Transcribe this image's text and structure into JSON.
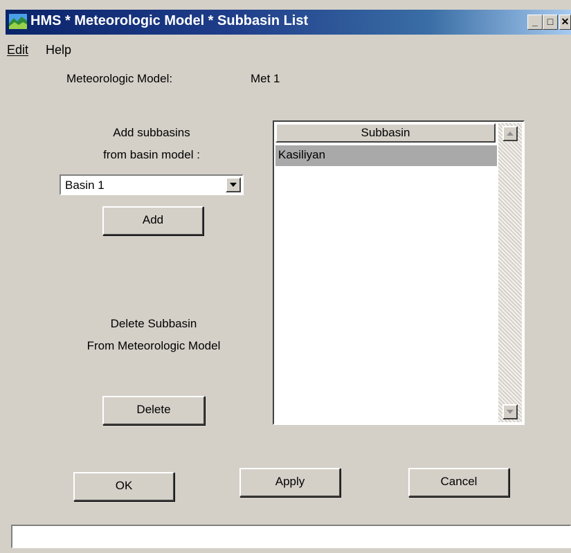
{
  "window": {
    "title": "HMS * Meteorologic Model * Subbasin List",
    "title_bar_color": "#0a246a",
    "face_color": "#d4d0c8",
    "caption_buttons": [
      "minimize",
      "maximize",
      "close"
    ]
  },
  "menu": {
    "items": [
      {
        "label": "Edit",
        "mnemonic": "E"
      },
      {
        "label": "Help"
      }
    ]
  },
  "met_model": {
    "label": "Meteorologic Model:",
    "value": "Met 1"
  },
  "add_section": {
    "label_line1": "Add subbasins",
    "label_line2": "from basin model :",
    "basin_select_value": "Basin 1",
    "add_label": "Add"
  },
  "delete_section": {
    "label_line1": "Delete Subbasin",
    "label_line2": "From Meteorologic Model",
    "delete_label": "Delete"
  },
  "subbasin_list": {
    "header": "Subbasin",
    "rows": [
      "Kasiliyan"
    ],
    "selected_row_color": "#a9a9a9"
  },
  "buttons": {
    "ok": "OK",
    "apply": "Apply",
    "cancel": "Cancel"
  },
  "status_bar": {
    "text": ""
  }
}
